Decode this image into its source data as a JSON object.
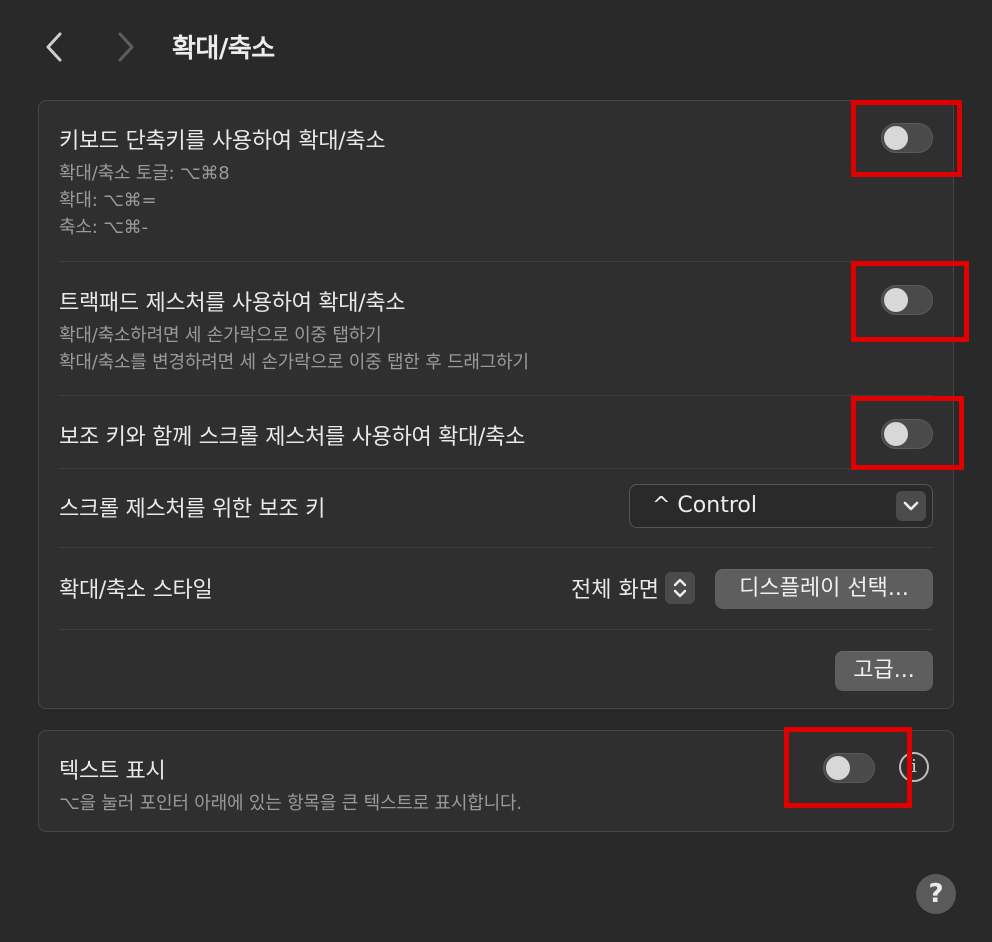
{
  "header": {
    "title": "확대/축소",
    "back_icon": "chevron-left-icon",
    "forward_icon": "chevron-right-icon"
  },
  "zoom_panel": {
    "keyboard": {
      "label": "키보드 단축키를 사용하여 확대/축소",
      "lines": [
        "확대/축소 토글: ⌥⌘8",
        "확대: ⌥⌘=",
        "축소: ⌥⌘-"
      ],
      "toggle": "off"
    },
    "trackpad": {
      "label": "트랙패드 제스처를 사용하여 확대/축소",
      "lines": [
        "확대/축소하려면 세 손가락으로 이중 탭하기",
        "확대/축소를 변경하려면 세 손가락으로 이중 탭한 후 드래그하기"
      ],
      "toggle": "off"
    },
    "scroll": {
      "label": "보조 키와 함께 스크롤 제스처를 사용하여 확대/축소",
      "toggle": "off"
    },
    "modifier": {
      "label": "스크롤 제스처를 위한 보조 키",
      "value": "^ Control"
    },
    "style": {
      "label": "확대/축소 스타일",
      "value": "전체 화면",
      "display_button": "디스플레이 선택..."
    },
    "advanced_button": "고급..."
  },
  "hover_text": {
    "label": "텍스트 표시",
    "description": "⌥을 눌러 포인터 아래에 있는 항목을 큰 텍스트로 표시합니다.",
    "toggle": "off",
    "info_glyph": "i"
  },
  "help_glyph": "?",
  "colors": {
    "background": "#292929",
    "panel": "#2f2f2f",
    "highlight_box": "#e10000"
  }
}
